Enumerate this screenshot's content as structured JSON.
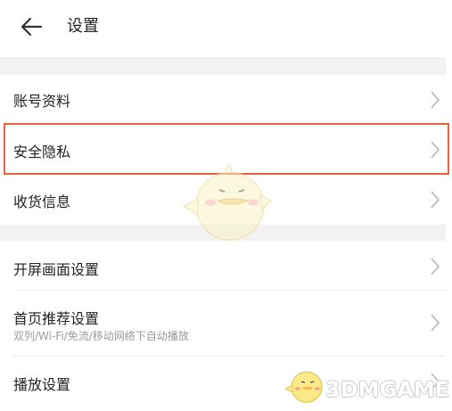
{
  "header": {
    "title": "设置",
    "back_icon": "arrow-left-icon"
  },
  "sections": [
    {
      "items": [
        {
          "label": "账号资料",
          "icon": "chevron-right-icon"
        },
        {
          "label": "安全隐私",
          "icon": "chevron-right-icon",
          "highlighted": true
        },
        {
          "label": "收货信息",
          "icon": "chevron-right-icon"
        }
      ]
    },
    {
      "items": [
        {
          "label": "开屏画面设置",
          "icon": "chevron-right-icon"
        },
        {
          "label": "首页推荐设置",
          "subtitle": "双列/Wi-Fi/免流/移动网络下自动播放",
          "icon": "chevron-right-icon"
        },
        {
          "label": "播放设置",
          "icon": "chevron-right-icon"
        }
      ]
    }
  ],
  "watermark": {
    "text": "3DMGAME"
  },
  "colors": {
    "highlight": "#e8603c",
    "section_gap": "#f2f2f2",
    "subtitle": "#9a9a9a"
  }
}
